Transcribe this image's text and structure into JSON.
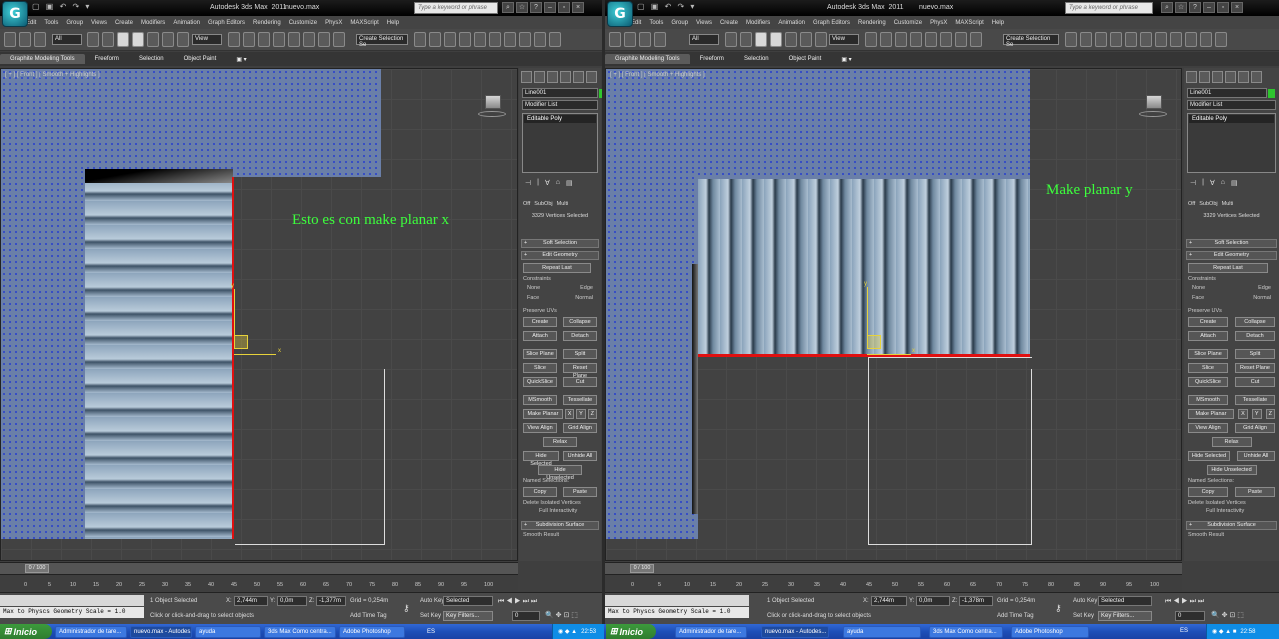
{
  "left": {
    "window_title": "Autodesk 3ds Max  2011",
    "file_name": "nuevo.max",
    "search_placeholder": "Type a keyword or phrase",
    "menus": [
      "Edit",
      "Tools",
      "Group",
      "Views",
      "Create",
      "Modifiers",
      "Animation",
      "Graph Editors",
      "Rendering",
      "Customize",
      "PhysX",
      "MAXScript",
      "Help"
    ],
    "toolbar": {
      "filter": "All",
      "view": "View",
      "selection_set": "Create Selection Se"
    },
    "ribbon_tabs": [
      "Graphite Modeling Tools",
      "Freeform",
      "Selection",
      "Object Paint",
      "▣ ▾"
    ],
    "viewport_label": "[ + ] [ Front ] [ Smooth + Highlights ]",
    "annotation": "Esto es con make planar x",
    "gizmo": {
      "x": "x",
      "y": "y"
    },
    "command_panel": {
      "object_name": "Line001",
      "modifier_list": "Modifier List",
      "stack_item": "Editable Poly",
      "radio_options": [
        "Off",
        "SubObj",
        "Multi"
      ],
      "vertices_selected": "3329 Vertices Selected",
      "soft_selection": "Soft Selection",
      "edit_geometry": "Edit Geometry",
      "repeat_last": "Repeat Last",
      "constraints": "Constraints",
      "c_none": "None",
      "c_edge": "Edge",
      "c_face": "Face",
      "c_normal": "Normal",
      "preserve_uvs": "Preserve UVs",
      "create": "Create",
      "collapse": "Collapse",
      "attach": "Attach",
      "detach": "Detach",
      "slice_plane": "Slice Plane",
      "split": "Split",
      "slice": "Slice",
      "reset_plane": "Reset Plane",
      "quickslice": "QuickSlice",
      "cut": "Cut",
      "msmooth": "MSmooth",
      "tessellate": "Tessellate",
      "make_planar": "Make Planar",
      "ax_x": "X",
      "ax_y": "Y",
      "ax_z": "Z",
      "view_align": "View Align",
      "grid_align": "Grid Align",
      "relax": "Relax",
      "hide_selected": "Hide Selected",
      "unhide_all": "Unhide All",
      "hide_unselected": "Hide Unselected",
      "named_selections": "Named Selections:",
      "copy": "Copy",
      "paste": "Paste",
      "delete_isolated": "Delete Isolated Vertices",
      "full_interactivity": "Full Interactivity",
      "subdivision_surface": "Subdivision Surface",
      "smooth_result": "Smooth Result"
    },
    "time_slider": "0 / 100",
    "ruler_ticks": [
      "0",
      "5",
      "10",
      "15",
      "20",
      "25",
      "30",
      "35",
      "40",
      "45",
      "50",
      "55",
      "60",
      "65",
      "70",
      "75",
      "80",
      "85",
      "90",
      "95",
      "100"
    ],
    "status": {
      "maxscript": "Max to Physcs Geometry Scale = 1.0",
      "objects_selected": "1 Object Selected",
      "prompt": "Click or click-and-drag to select objects",
      "x_label": "X:",
      "x_val": "2,744m",
      "y_label": "Y:",
      "y_val": "0,0m",
      "z_label": "Z:",
      "z_val": "-1,377m",
      "grid": "Grid = 0,254m",
      "add_time_tag": "Add Time Tag",
      "auto_key": "Auto Key",
      "set_key": "Set Key",
      "key_mode": "Selected",
      "key_filters": "Key Filters...",
      "frame": "0"
    }
  },
  "right": {
    "window_title": "Autodesk 3ds Max  2011",
    "file_name": "nuevo.max",
    "search_placeholder": "Type a keyword or phrase",
    "menus": [
      "Edit",
      "Tools",
      "Group",
      "Views",
      "Create",
      "Modifiers",
      "Animation",
      "Graph Editors",
      "Rendering",
      "Customize",
      "PhysX",
      "MAXScript",
      "Help"
    ],
    "toolbar": {
      "filter": "All",
      "view": "View",
      "selection_set": "Create Selection Se"
    },
    "ribbon_tabs": [
      "Graphite Modeling Tools",
      "Freeform",
      "Selection",
      "Object Paint",
      "▣ ▾"
    ],
    "viewport_label": "[ + ] [ Front ] [ Smooth + Highlights ]",
    "annotation": "Make planar y",
    "gizmo": {
      "x": "x",
      "y": "y"
    },
    "command_panel": {
      "object_name": "Line001",
      "modifier_list": "Modifier List",
      "stack_item": "Editable Poly",
      "radio_options": [
        "Off",
        "SubObj",
        "Multi"
      ],
      "vertices_selected": "3329 Vertices Selected",
      "soft_selection": "Soft Selection",
      "edit_geometry": "Edit Geometry",
      "repeat_last": "Repeat Last",
      "constraints": "Constraints",
      "c_none": "None",
      "c_edge": "Edge",
      "c_face": "Face",
      "c_normal": "Normal",
      "preserve_uvs": "Preserve UVs",
      "create": "Create",
      "collapse": "Collapse",
      "attach": "Attach",
      "detach": "Detach",
      "slice_plane": "Slice Plane",
      "split": "Split",
      "slice": "Slice",
      "reset_plane": "Reset Plane",
      "quickslice": "QuickSlice",
      "cut": "Cut",
      "msmooth": "MSmooth",
      "tessellate": "Tessellate",
      "make_planar": "Make Planar",
      "ax_x": "X",
      "ax_y": "Y",
      "ax_z": "Z",
      "view_align": "View Align",
      "grid_align": "Grid Align",
      "relax": "Relax",
      "hide_selected": "Hide Selected",
      "unhide_all": "Unhide All",
      "hide_unselected": "Hide Unselected",
      "named_selections": "Named Selections:",
      "copy": "Copy",
      "paste": "Paste",
      "delete_isolated": "Delete Isolated Vertices",
      "full_interactivity": "Full Interactivity",
      "subdivision_surface": "Subdivision Surface",
      "smooth_result": "Smooth Result"
    },
    "time_slider": "0 / 100",
    "ruler_ticks": [
      "0",
      "5",
      "10",
      "15",
      "20",
      "25",
      "30",
      "35",
      "40",
      "45",
      "50",
      "55",
      "60",
      "65",
      "70",
      "75",
      "80",
      "85",
      "90",
      "95",
      "100"
    ],
    "status": {
      "maxscript": "Max to Physcs Geometry Scale = 1.0",
      "objects_selected": "1 Object Selected",
      "prompt": "Click or click-and-drag to select objects",
      "x_label": "X:",
      "x_val": "2,744m",
      "y_label": "Y:",
      "y_val": "0,0m",
      "z_label": "Z:",
      "z_val": "-1,378m",
      "grid": "Grid = 0,254m",
      "add_time_tag": "Add Time Tag",
      "auto_key": "Auto Key",
      "set_key": "Set Key",
      "key_mode": "Selected",
      "key_filters": "Key Filters...",
      "frame": "0"
    }
  },
  "taskbar": {
    "start": "Inicio",
    "left_tasks": [
      "Administrador de tare...",
      "nuevo.max - Autodes...",
      "ayuda",
      "3ds Max Como centra...",
      "Adobe Photoshop"
    ],
    "left_lang": "ES",
    "left_clock": "22:53",
    "right_tasks": [
      "Administrador de tare...",
      "nuevo.max - Autodes...",
      "ayuda",
      "3ds Max Como centra...",
      "Adobe Photoshop"
    ],
    "right_lang": "ES",
    "right_clock": "22:58"
  },
  "colors": {
    "annotation": "#3cff3c",
    "selected_edge": "#e01010",
    "gizmo": "#e7d23b",
    "vertex": "#2f47c9"
  }
}
